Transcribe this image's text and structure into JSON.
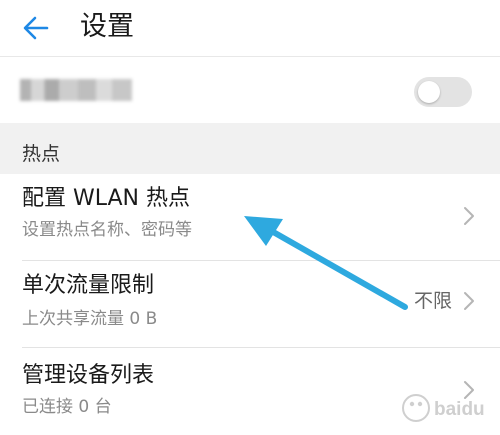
{
  "header": {
    "back_icon": "back-arrow-icon",
    "title": "设置",
    "accent_color": "#1e88e5"
  },
  "toggle_row": {
    "label_obscured": true,
    "switch_on": false
  },
  "section": {
    "title": "热点"
  },
  "rows": [
    {
      "title": "配置 WLAN 热点",
      "subtitle": "设置热点名称、密码等",
      "value": "",
      "chevron_icon": "chevron-right-icon"
    },
    {
      "title": "单次流量限制",
      "subtitle": "上次共享流量 0 B",
      "value": "不限",
      "chevron_icon": "chevron-right-icon"
    },
    {
      "title": "管理设备列表",
      "subtitle": "已连接 0 台",
      "value": "",
      "chevron_icon": "chevron-right-icon"
    }
  ],
  "annotation": {
    "arrow_color": "#2ea9df",
    "arrow_icon": "pointer-arrow-annotation"
  },
  "watermark": {
    "text": "baidu"
  }
}
